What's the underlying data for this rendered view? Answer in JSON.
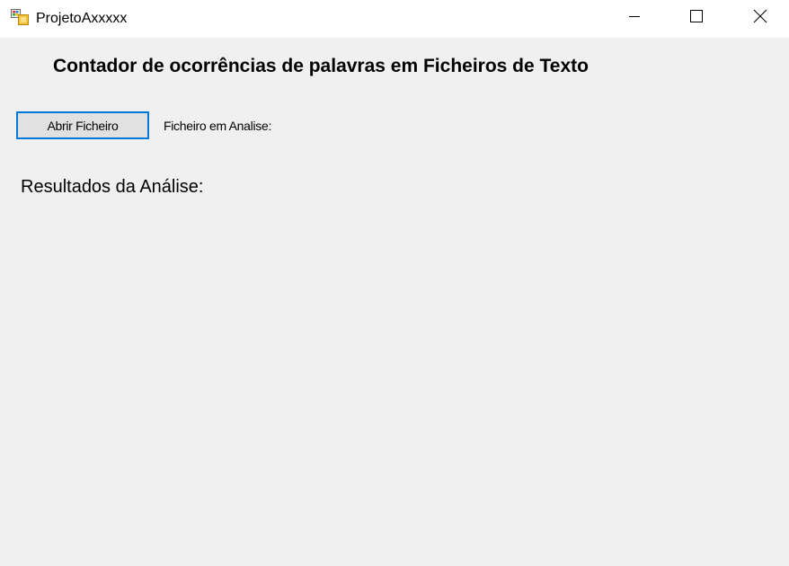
{
  "window": {
    "title": "ProjetoAxxxxx",
    "icon": "windows-form-icon",
    "controls": {
      "minimize_icon": "minimize-icon",
      "maximize_icon": "maximize-icon",
      "close_icon": "close-icon"
    }
  },
  "main": {
    "heading": "Contador de ocorrências de palavras em Ficheiros de Texto",
    "open_button_label": "Abrir Ficheiro",
    "file_label": "Ficheiro em Analise:",
    "results_label": "Resultados da Análise:"
  },
  "colors": {
    "background": "#f0f0f0",
    "titlebar": "#ffffff",
    "button_focus_border": "#0078d7",
    "button_face": "#e1e1e1"
  }
}
